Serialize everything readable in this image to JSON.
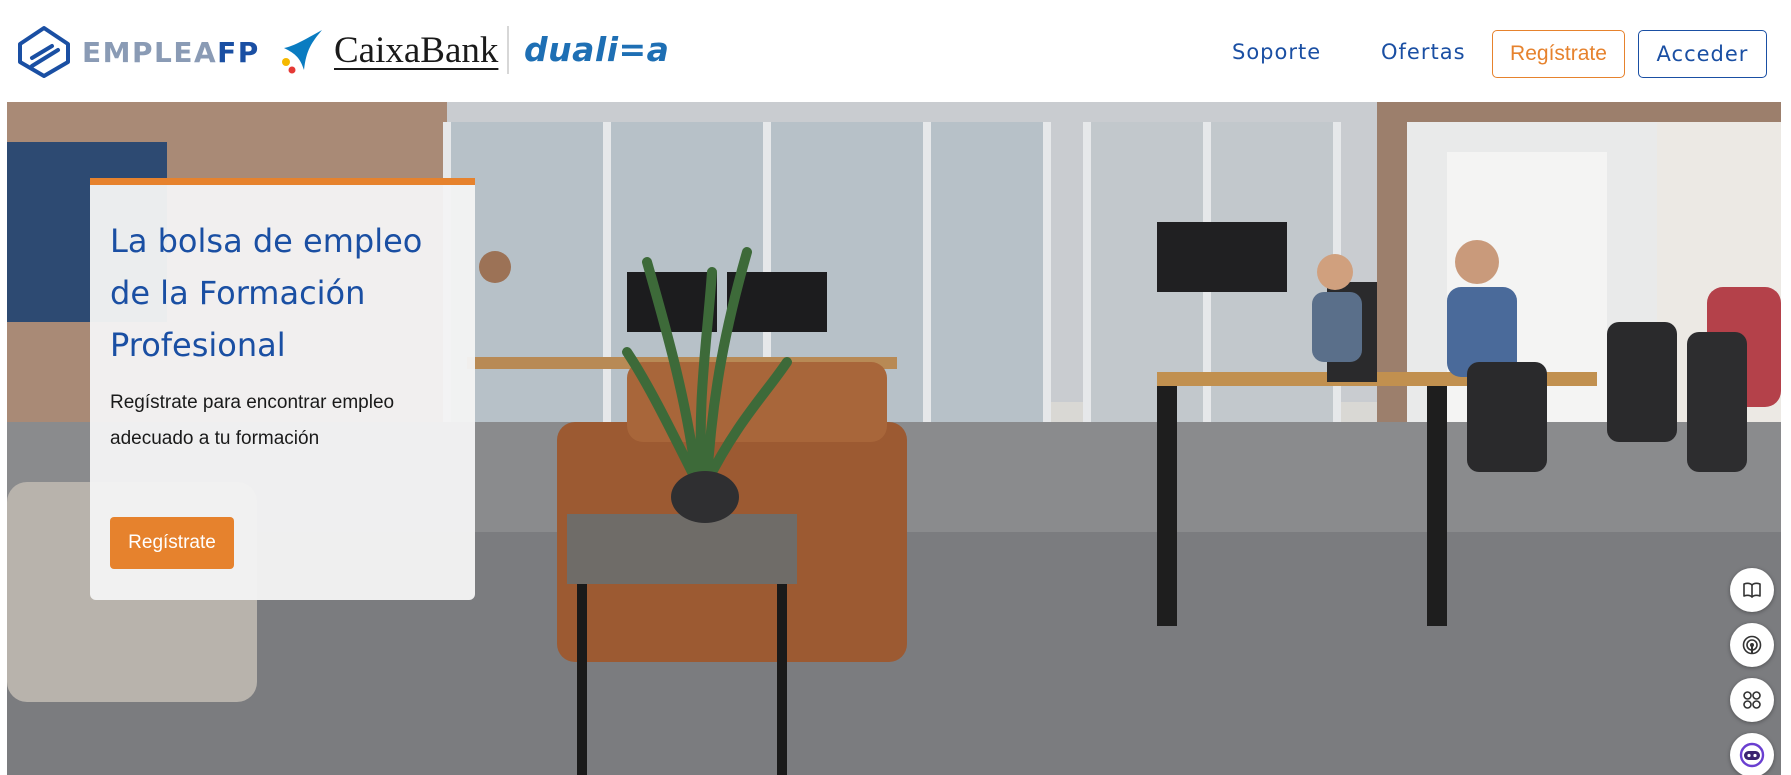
{
  "header": {
    "logos": {
      "emplea_part1": "EMPLEA",
      "emplea_part2": "FP",
      "caixabank": "CaixaBank",
      "dualiza": "duali=a"
    },
    "nav": {
      "soporte": "Soporte",
      "ofertas": "Ofertas",
      "registrate": "Regístrate",
      "acceder": "Acceder"
    }
  },
  "hero": {
    "title": "La bolsa de empleo de la Formación Profesional",
    "subtitle": "Regístrate para encontrar empleo adecuado a tu formación",
    "cta": "Regístrate"
  },
  "floating_tools": [
    "book-icon",
    "signal-icon",
    "grid-icon",
    "assistant-face-icon"
  ],
  "colors": {
    "brand_blue": "#1a4fa3",
    "accent_orange": "#e6822d",
    "logo_gray": "#8a9bb5",
    "dualiza_blue": "#1e6fb4"
  }
}
